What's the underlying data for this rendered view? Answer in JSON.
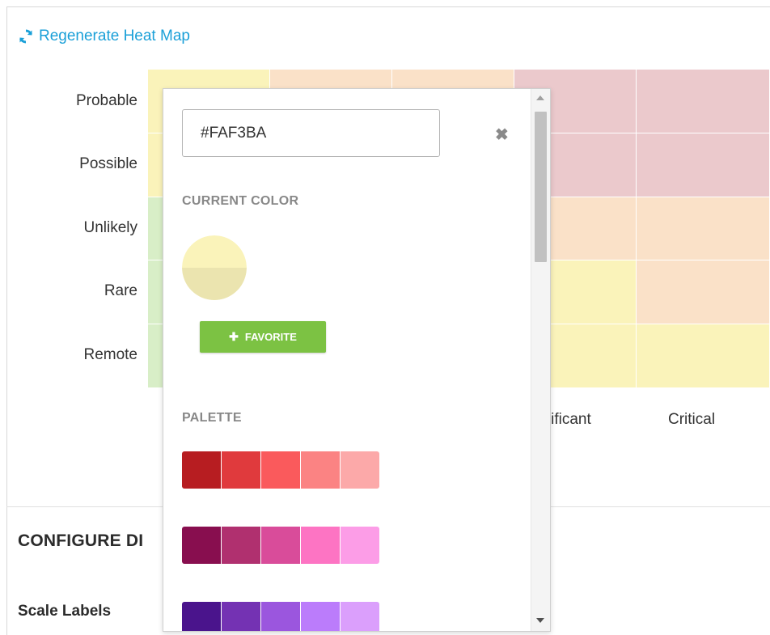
{
  "regenerate": {
    "label": "Regenerate Heat Map",
    "icon": "refresh-icon",
    "color": "#1ba0d8"
  },
  "heatmap": {
    "row_labels": [
      "Probable",
      "Possible",
      "Unlikely",
      "Rare",
      "Remote"
    ],
    "col_labels": [
      "gnificant",
      "Critical"
    ],
    "colors": {
      "red": "#ebc9cc",
      "orange": "#fae1c8",
      "yellow": "#faf3ba",
      "green": "#d8eec7"
    },
    "cells": [
      [
        "yellow",
        "orange",
        "orange",
        "red",
        "red"
      ],
      [
        "yellow",
        "orange",
        "orange",
        "red",
        "red"
      ],
      [
        "green",
        "yellow",
        "orange",
        "orange",
        "orange"
      ],
      [
        "green",
        "yellow",
        "yellow",
        "yellow",
        "orange"
      ],
      [
        "green",
        "green",
        "yellow",
        "yellow",
        "yellow"
      ]
    ]
  },
  "configure": {
    "title": "CONFIGURE DI",
    "scale_labels": "Scale Labels"
  },
  "color_picker": {
    "hex_value": "#FAF3BA",
    "close_icon": "close-icon",
    "current_color_label": "CURRENT COLOR",
    "current_color": "#FAF3BA",
    "favorite_label": "FAVORITE",
    "favorite_color": "#7cc243",
    "palette_label": "PALETTE",
    "palette_rows": [
      [
        "#b71d21",
        "#e03a3d",
        "#fa5a5c",
        "#fb8383",
        "#fca9a9"
      ],
      [
        "#880e4f",
        "#b0306f",
        "#d94c9a",
        "#fd74c3",
        "#fc9de7"
      ],
      [
        "#4a148c",
        "#7432b3",
        "#9b56de",
        "#bb7cfb",
        "#db9ffc"
      ]
    ]
  }
}
